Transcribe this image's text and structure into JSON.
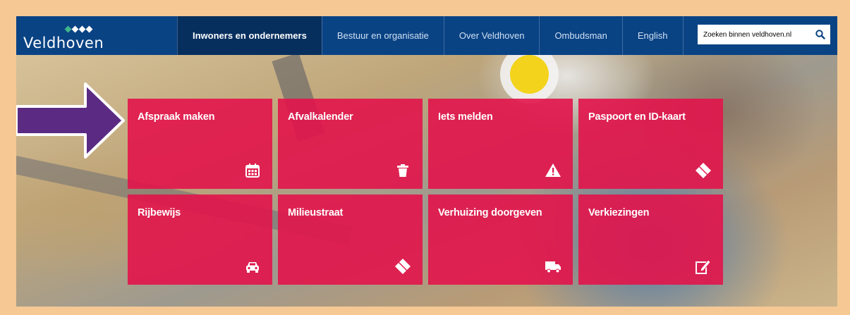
{
  "header": {
    "logo_text": "Veldhoven",
    "logo_mark_colors": [
      "#3fb68b",
      "#ffffff",
      "#ffffff",
      "#ffffff"
    ],
    "nav": [
      {
        "label": "Inwoners en ondernemers",
        "active": true
      },
      {
        "label": "Bestuur en organisatie",
        "active": false
      },
      {
        "label": "Over Veldhoven",
        "active": false
      },
      {
        "label": "Ombudsman",
        "active": false
      },
      {
        "label": "English",
        "active": false
      }
    ],
    "search": {
      "value": "Zoeken binnen veldhoven.nl",
      "icon": "search-icon"
    }
  },
  "tiles": [
    {
      "label": "Afspraak maken",
      "icon": "calendar-icon"
    },
    {
      "label": "Afvalkalender",
      "icon": "trash-icon"
    },
    {
      "label": "Iets melden",
      "icon": "warning-icon"
    },
    {
      "label": "Paspoort en ID-kaart",
      "icon": "eraser-icon"
    },
    {
      "label": "Rijbewijs",
      "icon": "car-icon"
    },
    {
      "label": "Milieustraat",
      "icon": "eraser-icon"
    },
    {
      "label": "Verhuizing doorgeven",
      "icon": "truck-icon"
    },
    {
      "label": "Verkiezingen",
      "icon": "pencil-edit-icon"
    }
  ],
  "colors": {
    "frame": "#f5c894",
    "header": "#0a4384",
    "active_nav": "#072f5e",
    "tile": "#e2144b",
    "arrow": "#5b2a83"
  }
}
